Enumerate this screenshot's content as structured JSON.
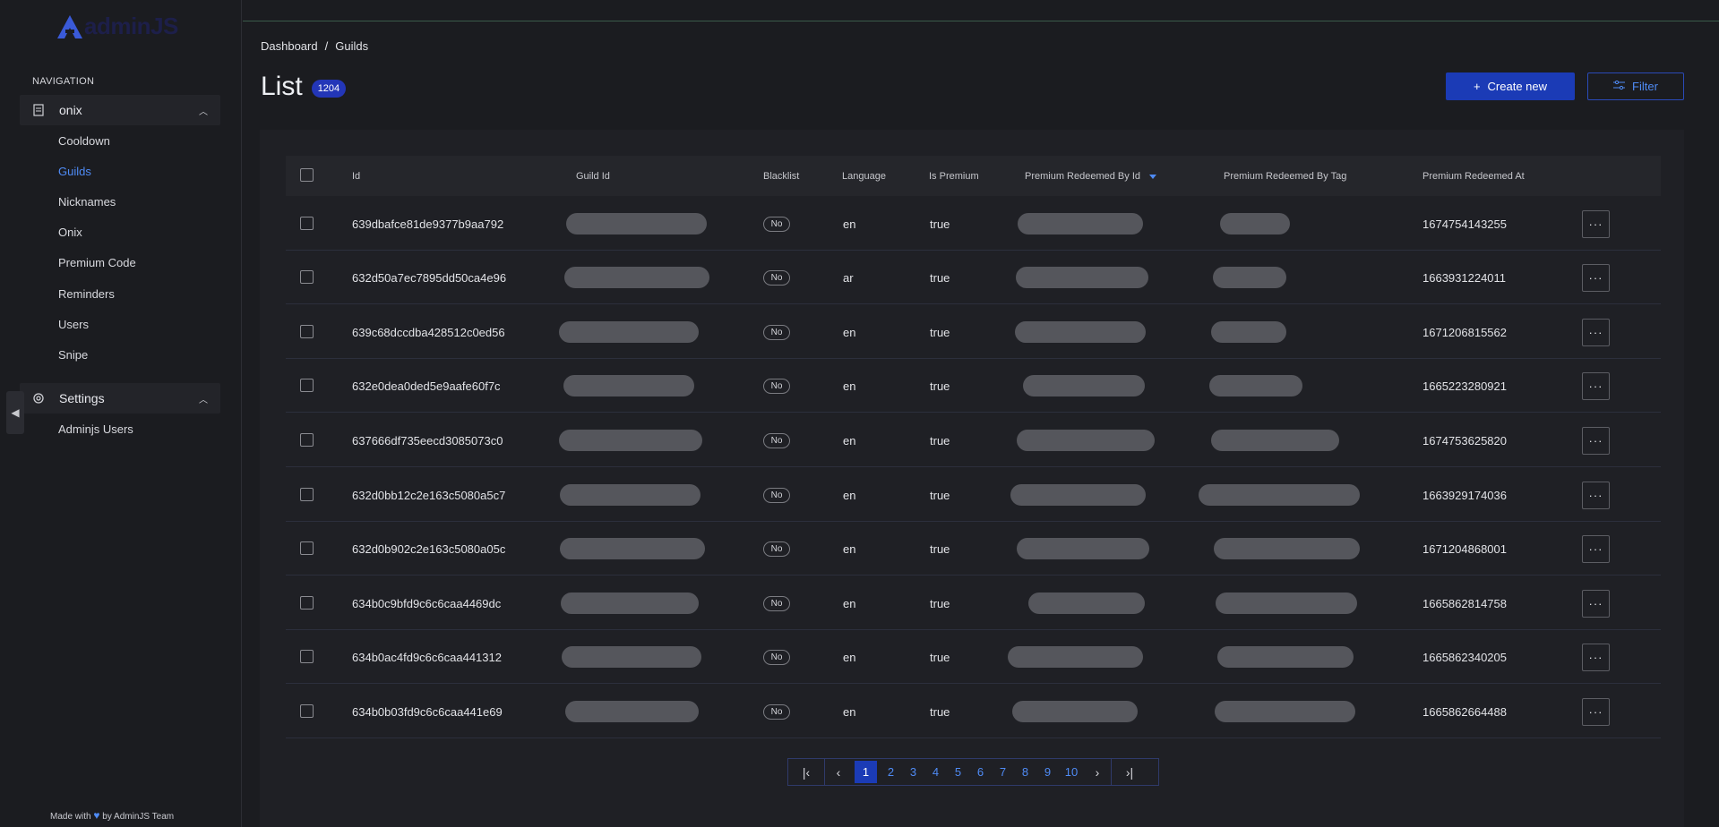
{
  "app": {
    "logo_text": "adminJS"
  },
  "sidebar": {
    "heading": "NAVIGATION",
    "groups": [
      {
        "label": "onix",
        "items": [
          "Cooldown",
          "Guilds",
          "Nicknames",
          "Onix",
          "Premium Code",
          "Reminders",
          "Users",
          "Snipe"
        ]
      },
      {
        "label": "Settings",
        "items": [
          "Adminjs Users"
        ]
      }
    ],
    "active_item": "Guilds",
    "footer": {
      "prefix": "Made with",
      "suffix": "by AdminJS Team"
    }
  },
  "breadcrumb": {
    "root": "Dashboard",
    "separator": "/",
    "current": "Guilds"
  },
  "page": {
    "title": "List",
    "count": "1204"
  },
  "actions": {
    "create_label": "Create new",
    "filter_label": "Filter"
  },
  "table": {
    "headers": {
      "id": "Id",
      "guild_id": "Guild Id",
      "blacklist": "Blacklist",
      "language": "Language",
      "is_premium": "Is Premium",
      "redeemed_by_id": "Premium Redeemed By Id",
      "redeemed_by_tag": "Premium Redeemed By Tag",
      "redeemed_at": "Premium Redeemed At"
    },
    "rows": [
      {
        "id": "639dbafce81de9377b9aa792",
        "blacklist": "No",
        "language": "en",
        "is_premium": "true",
        "redeemed_at": "1674754143255"
      },
      {
        "id": "632d50a7ec7895dd50ca4e96",
        "blacklist": "No",
        "language": "ar",
        "is_premium": "true",
        "redeemed_at": "1663931224011"
      },
      {
        "id": "639c68dccdba428512c0ed56",
        "blacklist": "No",
        "language": "en",
        "is_premium": "true",
        "redeemed_at": "1671206815562"
      },
      {
        "id": "632e0dea0ded5e9aafe60f7c",
        "blacklist": "No",
        "language": "en",
        "is_premium": "true",
        "redeemed_at": "1665223280921"
      },
      {
        "id": "637666df735eecd3085073c0",
        "blacklist": "No",
        "language": "en",
        "is_premium": "true",
        "redeemed_at": "1674753625820"
      },
      {
        "id": "632d0bb12c2e163c5080a5c7",
        "blacklist": "No",
        "language": "en",
        "is_premium": "true",
        "redeemed_at": "1663929174036"
      },
      {
        "id": "632d0b902c2e163c5080a05c",
        "blacklist": "No",
        "language": "en",
        "is_premium": "true",
        "redeemed_at": "1671204868001"
      },
      {
        "id": "634b0c9bfd9c6c6caa4469dc",
        "blacklist": "No",
        "language": "en",
        "is_premium": "true",
        "redeemed_at": "1665862814758"
      },
      {
        "id": "634b0ac4fd9c6c6caa441312",
        "blacklist": "No",
        "language": "en",
        "is_premium": "true",
        "redeemed_at": "1665862340205"
      },
      {
        "id": "634b0b03fd9c6c6caa441e69",
        "blacklist": "No",
        "language": "en",
        "is_premium": "true",
        "redeemed_at": "1665862664488"
      }
    ],
    "row_action_label": "···"
  },
  "pagination": {
    "pages": [
      "1",
      "2",
      "3",
      "4",
      "5",
      "6",
      "7",
      "8",
      "9",
      "10"
    ],
    "current": "1"
  },
  "colors": {
    "accent": "#1b3bb6",
    "link": "#4f8bf5",
    "background": "#1b1c20"
  }
}
